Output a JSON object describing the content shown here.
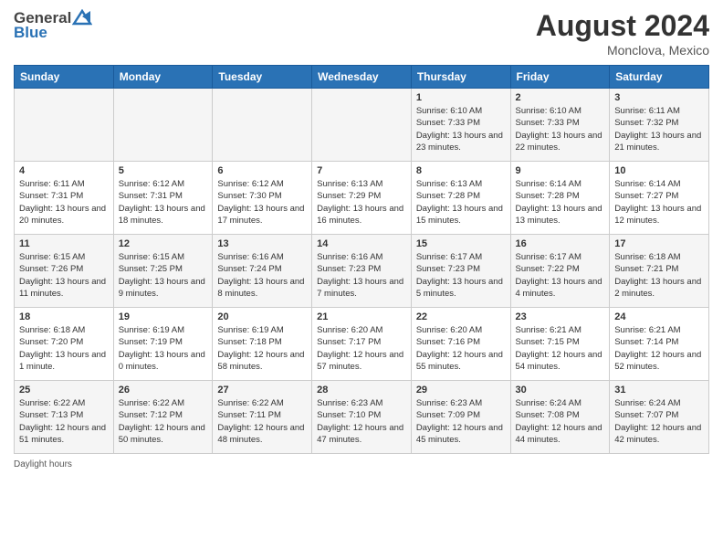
{
  "logo": {
    "general": "General",
    "blue": "Blue"
  },
  "title": "August 2024",
  "location": "Monclova, Mexico",
  "days_of_week": [
    "Sunday",
    "Monday",
    "Tuesday",
    "Wednesday",
    "Thursday",
    "Friday",
    "Saturday"
  ],
  "footer": "Daylight hours",
  "weeks": [
    [
      {
        "day": "",
        "sunrise": "",
        "sunset": "",
        "daylight": ""
      },
      {
        "day": "",
        "sunrise": "",
        "sunset": "",
        "daylight": ""
      },
      {
        "day": "",
        "sunrise": "",
        "sunset": "",
        "daylight": ""
      },
      {
        "day": "",
        "sunrise": "",
        "sunset": "",
        "daylight": ""
      },
      {
        "day": "1",
        "sunrise": "Sunrise: 6:10 AM",
        "sunset": "Sunset: 7:33 PM",
        "daylight": "Daylight: 13 hours and 23 minutes."
      },
      {
        "day": "2",
        "sunrise": "Sunrise: 6:10 AM",
        "sunset": "Sunset: 7:33 PM",
        "daylight": "Daylight: 13 hours and 22 minutes."
      },
      {
        "day": "3",
        "sunrise": "Sunrise: 6:11 AM",
        "sunset": "Sunset: 7:32 PM",
        "daylight": "Daylight: 13 hours and 21 minutes."
      }
    ],
    [
      {
        "day": "4",
        "sunrise": "Sunrise: 6:11 AM",
        "sunset": "Sunset: 7:31 PM",
        "daylight": "Daylight: 13 hours and 20 minutes."
      },
      {
        "day": "5",
        "sunrise": "Sunrise: 6:12 AM",
        "sunset": "Sunset: 7:31 PM",
        "daylight": "Daylight: 13 hours and 18 minutes."
      },
      {
        "day": "6",
        "sunrise": "Sunrise: 6:12 AM",
        "sunset": "Sunset: 7:30 PM",
        "daylight": "Daylight: 13 hours and 17 minutes."
      },
      {
        "day": "7",
        "sunrise": "Sunrise: 6:13 AM",
        "sunset": "Sunset: 7:29 PM",
        "daylight": "Daylight: 13 hours and 16 minutes."
      },
      {
        "day": "8",
        "sunrise": "Sunrise: 6:13 AM",
        "sunset": "Sunset: 7:28 PM",
        "daylight": "Daylight: 13 hours and 15 minutes."
      },
      {
        "day": "9",
        "sunrise": "Sunrise: 6:14 AM",
        "sunset": "Sunset: 7:28 PM",
        "daylight": "Daylight: 13 hours and 13 minutes."
      },
      {
        "day": "10",
        "sunrise": "Sunrise: 6:14 AM",
        "sunset": "Sunset: 7:27 PM",
        "daylight": "Daylight: 13 hours and 12 minutes."
      }
    ],
    [
      {
        "day": "11",
        "sunrise": "Sunrise: 6:15 AM",
        "sunset": "Sunset: 7:26 PM",
        "daylight": "Daylight: 13 hours and 11 minutes."
      },
      {
        "day": "12",
        "sunrise": "Sunrise: 6:15 AM",
        "sunset": "Sunset: 7:25 PM",
        "daylight": "Daylight: 13 hours and 9 minutes."
      },
      {
        "day": "13",
        "sunrise": "Sunrise: 6:16 AM",
        "sunset": "Sunset: 7:24 PM",
        "daylight": "Daylight: 13 hours and 8 minutes."
      },
      {
        "day": "14",
        "sunrise": "Sunrise: 6:16 AM",
        "sunset": "Sunset: 7:23 PM",
        "daylight": "Daylight: 13 hours and 7 minutes."
      },
      {
        "day": "15",
        "sunrise": "Sunrise: 6:17 AM",
        "sunset": "Sunset: 7:23 PM",
        "daylight": "Daylight: 13 hours and 5 minutes."
      },
      {
        "day": "16",
        "sunrise": "Sunrise: 6:17 AM",
        "sunset": "Sunset: 7:22 PM",
        "daylight": "Daylight: 13 hours and 4 minutes."
      },
      {
        "day": "17",
        "sunrise": "Sunrise: 6:18 AM",
        "sunset": "Sunset: 7:21 PM",
        "daylight": "Daylight: 13 hours and 2 minutes."
      }
    ],
    [
      {
        "day": "18",
        "sunrise": "Sunrise: 6:18 AM",
        "sunset": "Sunset: 7:20 PM",
        "daylight": "Daylight: 13 hours and 1 minute."
      },
      {
        "day": "19",
        "sunrise": "Sunrise: 6:19 AM",
        "sunset": "Sunset: 7:19 PM",
        "daylight": "Daylight: 13 hours and 0 minutes."
      },
      {
        "day": "20",
        "sunrise": "Sunrise: 6:19 AM",
        "sunset": "Sunset: 7:18 PM",
        "daylight": "Daylight: 12 hours and 58 minutes."
      },
      {
        "day": "21",
        "sunrise": "Sunrise: 6:20 AM",
        "sunset": "Sunset: 7:17 PM",
        "daylight": "Daylight: 12 hours and 57 minutes."
      },
      {
        "day": "22",
        "sunrise": "Sunrise: 6:20 AM",
        "sunset": "Sunset: 7:16 PM",
        "daylight": "Daylight: 12 hours and 55 minutes."
      },
      {
        "day": "23",
        "sunrise": "Sunrise: 6:21 AM",
        "sunset": "Sunset: 7:15 PM",
        "daylight": "Daylight: 12 hours and 54 minutes."
      },
      {
        "day": "24",
        "sunrise": "Sunrise: 6:21 AM",
        "sunset": "Sunset: 7:14 PM",
        "daylight": "Daylight: 12 hours and 52 minutes."
      }
    ],
    [
      {
        "day": "25",
        "sunrise": "Sunrise: 6:22 AM",
        "sunset": "Sunset: 7:13 PM",
        "daylight": "Daylight: 12 hours and 51 minutes."
      },
      {
        "day": "26",
        "sunrise": "Sunrise: 6:22 AM",
        "sunset": "Sunset: 7:12 PM",
        "daylight": "Daylight: 12 hours and 50 minutes."
      },
      {
        "day": "27",
        "sunrise": "Sunrise: 6:22 AM",
        "sunset": "Sunset: 7:11 PM",
        "daylight": "Daylight: 12 hours and 48 minutes."
      },
      {
        "day": "28",
        "sunrise": "Sunrise: 6:23 AM",
        "sunset": "Sunset: 7:10 PM",
        "daylight": "Daylight: 12 hours and 47 minutes."
      },
      {
        "day": "29",
        "sunrise": "Sunrise: 6:23 AM",
        "sunset": "Sunset: 7:09 PM",
        "daylight": "Daylight: 12 hours and 45 minutes."
      },
      {
        "day": "30",
        "sunrise": "Sunrise: 6:24 AM",
        "sunset": "Sunset: 7:08 PM",
        "daylight": "Daylight: 12 hours and 44 minutes."
      },
      {
        "day": "31",
        "sunrise": "Sunrise: 6:24 AM",
        "sunset": "Sunset: 7:07 PM",
        "daylight": "Daylight: 12 hours and 42 minutes."
      }
    ]
  ]
}
